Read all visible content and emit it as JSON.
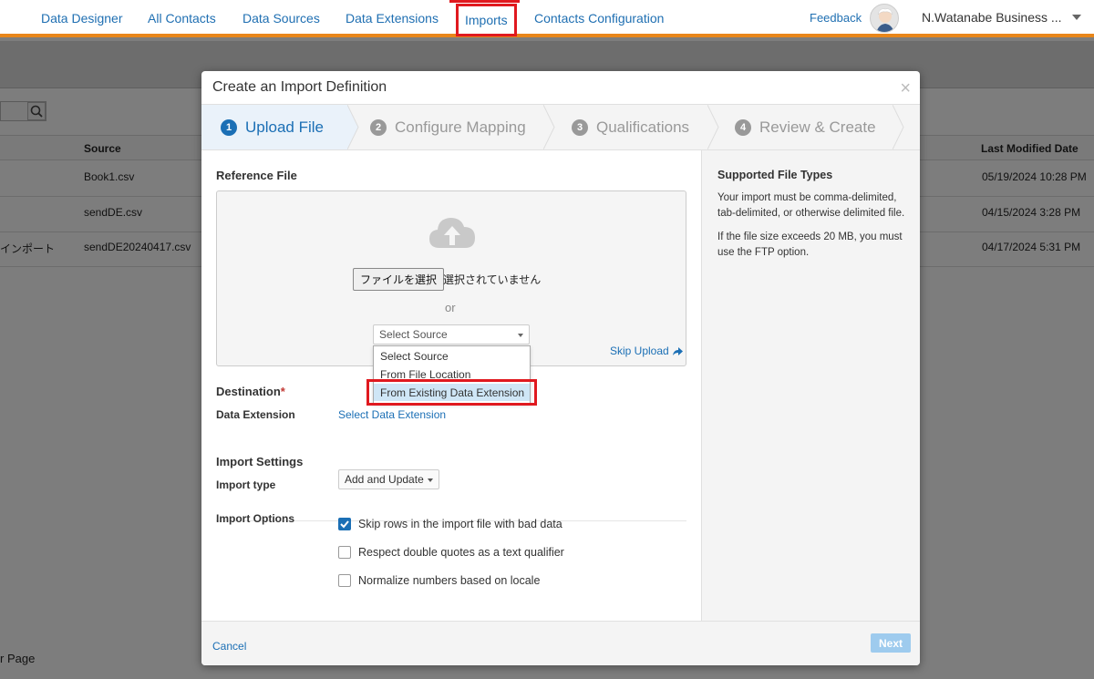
{
  "nav": {
    "items": [
      "Data Designer",
      "All Contacts",
      "Data Sources",
      "Data Extensions",
      "Imports",
      "Contacts Configuration"
    ],
    "feedback": "Feedback",
    "business_unit": "N.Watanabe Business ..."
  },
  "background": {
    "headers": {
      "source": "Source",
      "last_modified": "Last Modified Date"
    },
    "rows": [
      {
        "name": "",
        "source": "Book1.csv",
        "date": "05/19/2024 10:28 PM"
      },
      {
        "name": "",
        "source": "sendDE.csv",
        "date": "04/15/2024 3:28 PM"
      },
      {
        "name": "インポート",
        "source": "sendDE20240417.csv",
        "date": "04/17/2024 5:31 PM"
      }
    ],
    "footer_text": "r Page"
  },
  "modal": {
    "title": "Create an Import Definition",
    "close": "×",
    "steps": [
      {
        "num": "1",
        "label": "Upload File"
      },
      {
        "num": "2",
        "label": "Configure Mapping"
      },
      {
        "num": "3",
        "label": "Qualifications"
      },
      {
        "num": "4",
        "label": "Review & Create"
      }
    ],
    "reference_file": {
      "title": "Reference File",
      "file_button": "ファイルを選択",
      "no_file": "選択されていません",
      "or": "or",
      "select_value": "Select Source",
      "skip_upload": "Skip Upload",
      "options": [
        "Select Source",
        "From File Location",
        "From Existing Data Extension"
      ]
    },
    "destination": {
      "title": "Destination",
      "required": "*",
      "field_label": "Data Extension",
      "link": "Select Data Extension"
    },
    "import_settings": {
      "title": "Import Settings",
      "type_label": "Import type",
      "type_value": "Add and Update",
      "options_label": "Import Options",
      "options": [
        {
          "label": "Skip rows in the import file with bad data",
          "checked": true
        },
        {
          "label": "Respect double quotes as a text qualifier",
          "checked": false
        },
        {
          "label": "Normalize numbers based on locale",
          "checked": false
        }
      ]
    },
    "sidebar": {
      "title": "Supported File Types",
      "p1": "Your import must be comma-delimited, tab-delimited, or otherwise delimited file.",
      "p2": "If the file size exceeds 20 MB, you must use the FTP option."
    },
    "footer": {
      "cancel": "Cancel",
      "next": "Next"
    }
  },
  "colors": {
    "accent": "#1b6fb5",
    "nav_border": "#e8861a",
    "highlight": "#e0191f"
  }
}
